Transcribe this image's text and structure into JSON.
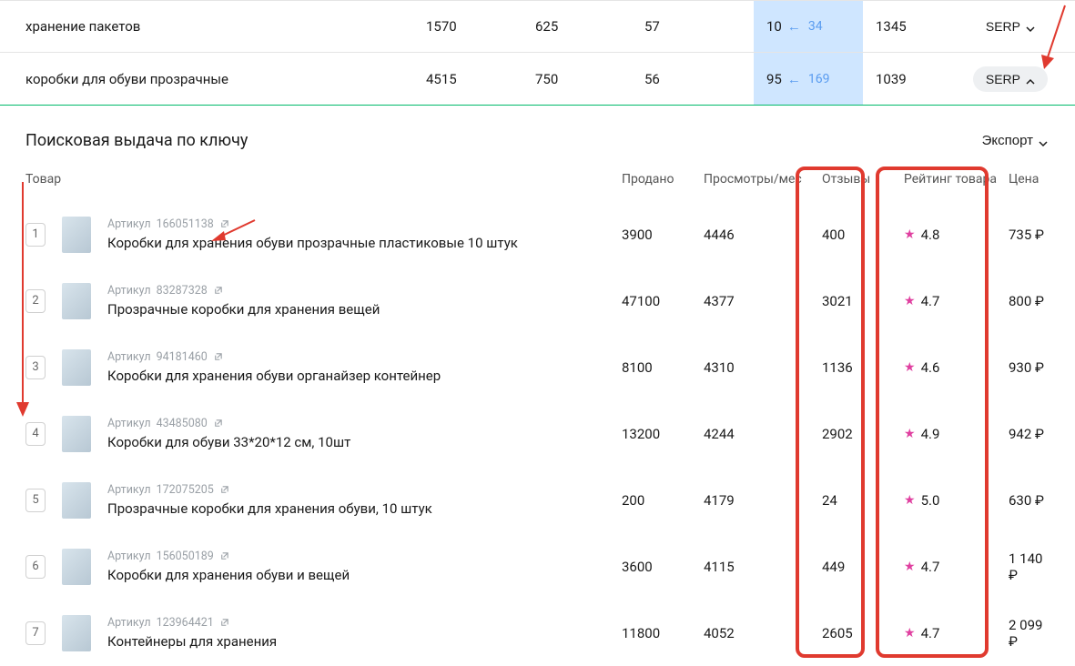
{
  "keyword_rows": [
    {
      "keyword": "хранение пакетов",
      "c1": "1570",
      "c2": "625",
      "c3": "57",
      "pos": "10",
      "prev": "34",
      "c5": "1345",
      "serp_expanded": false
    },
    {
      "keyword": "коробки для обуви прозрачные",
      "c1": "4515",
      "c2": "750",
      "c3": "56",
      "pos": "95",
      "prev": "169",
      "c5": "1039",
      "serp_expanded": true
    }
  ],
  "serp_label": "SERP",
  "sub": {
    "title": "Поисковая выдача по ключу",
    "export": "Экспорт"
  },
  "headers": {
    "product": "Товар",
    "sold": "Продано",
    "views": "Просмотры/мес",
    "reviews": "Отзывы",
    "rating": "Рейтинг товара",
    "price": "Цена"
  },
  "sku_prefix": "Артикул",
  "currency": "₽",
  "products": [
    {
      "idx": "1",
      "sku": "166051138",
      "title": "Коробки для хранения обуви прозрачные пластиковые 10 штук",
      "sold": "3900",
      "views": "4446",
      "reviews": "400",
      "rating": "4.8",
      "price": "735"
    },
    {
      "idx": "2",
      "sku": "83287328",
      "title": "Прозрачные коробки для хранения вещей",
      "sold": "47100",
      "views": "4377",
      "reviews": "3021",
      "rating": "4.7",
      "price": "800"
    },
    {
      "idx": "3",
      "sku": "94181460",
      "title": "Коробки для хранения обуви органайзер контейнер",
      "sold": "8100",
      "views": "4310",
      "reviews": "1136",
      "rating": "4.6",
      "price": "930"
    },
    {
      "idx": "4",
      "sku": "43485080",
      "title": "Коробки для обуви 33*20*12 см, 10шт",
      "sold": "13200",
      "views": "4244",
      "reviews": "2902",
      "rating": "4.9",
      "price": "942"
    },
    {
      "idx": "5",
      "sku": "172075205",
      "title": "Прозрачные коробки для хранения обуви, 10 штук",
      "sold": "200",
      "views": "4179",
      "reviews": "24",
      "rating": "5.0",
      "price": "630"
    },
    {
      "idx": "6",
      "sku": "156050189",
      "title": "Коробки для хранения обуви и вещей",
      "sold": "3600",
      "views": "4115",
      "reviews": "449",
      "rating": "4.7",
      "price": "1 140"
    },
    {
      "idx": "7",
      "sku": "123964421",
      "title": "Контейнеры для хранения",
      "sold": "11800",
      "views": "4052",
      "reviews": "2605",
      "rating": "4.7",
      "price": "2 099"
    }
  ]
}
